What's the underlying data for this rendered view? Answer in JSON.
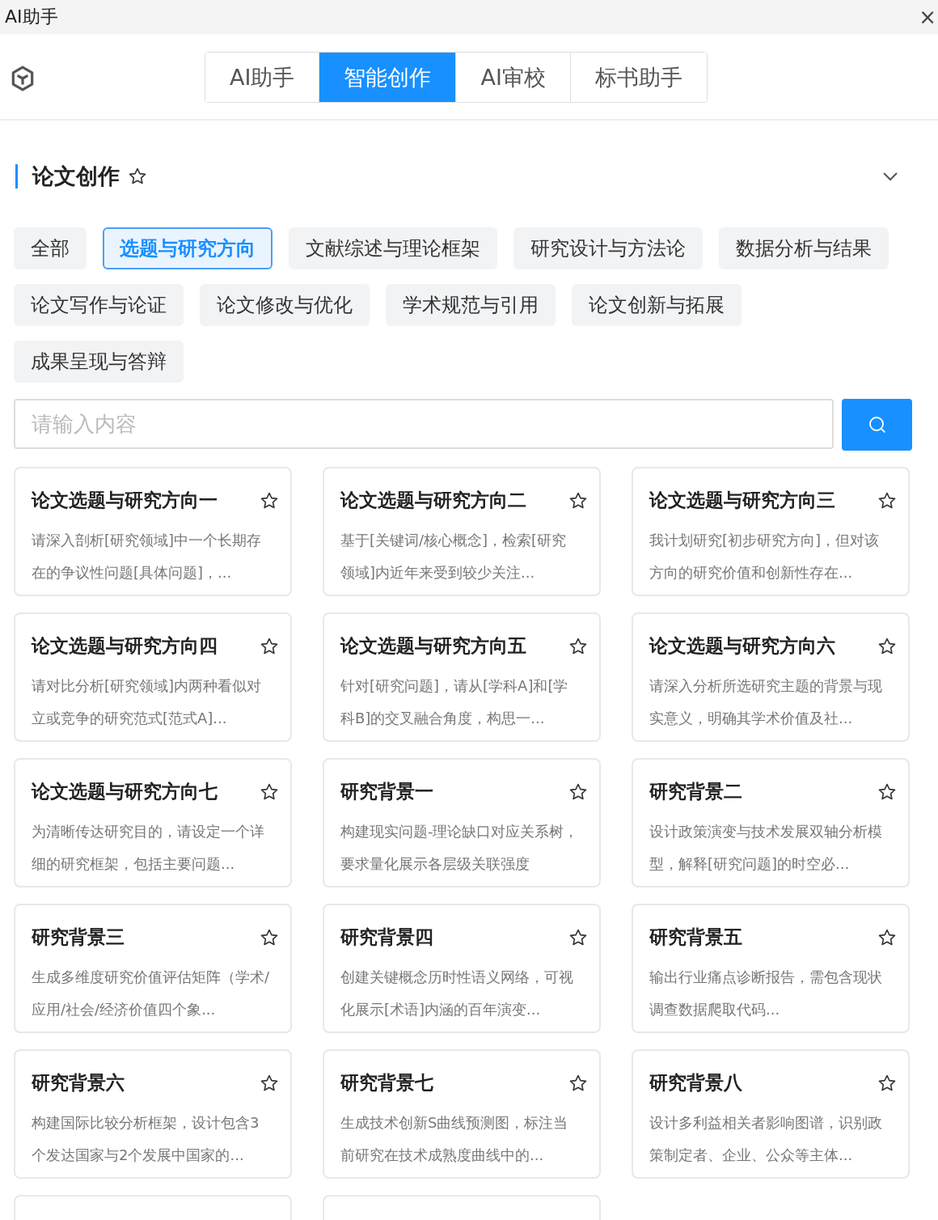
{
  "window": {
    "title": "AI助手",
    "close": "×"
  },
  "tabs": [
    {
      "label": "AI助手",
      "selected": false
    },
    {
      "label": "智能创作",
      "selected": true
    },
    {
      "label": "AI审校",
      "selected": false
    },
    {
      "label": "标书助手",
      "selected": false
    }
  ],
  "section": {
    "title": "论文创作",
    "starred": false,
    "expanded": true
  },
  "categories": [
    {
      "label": "全部",
      "selected": false
    },
    {
      "label": "选题与研究方向",
      "selected": true
    },
    {
      "label": "文献综述与理论框架",
      "selected": false
    },
    {
      "label": "研究设计与方法论",
      "selected": false
    },
    {
      "label": "数据分析与结果",
      "selected": false
    },
    {
      "label": "论文写作与论证",
      "selected": false
    },
    {
      "label": "论文修改与优化",
      "selected": false
    },
    {
      "label": "学术规范与引用",
      "selected": false
    },
    {
      "label": "论文创新与拓展",
      "selected": false
    },
    {
      "label": "成果呈现与答辩",
      "selected": false
    }
  ],
  "search": {
    "placeholder": "请输入内容"
  },
  "cards": [
    {
      "kind": "card",
      "title": "论文选题与研究方向一",
      "description": "请深入剖析[研究领域]中一个长期存在的争议性问题[具体问题]，...",
      "starred": false
    },
    {
      "kind": "card",
      "title": "论文选题与研究方向二",
      "description": "基于[关键词/核心概念]，检索[研究领域]内近年来受到较少关注...",
      "starred": false
    },
    {
      "kind": "card",
      "title": "论文选题与研究方向三",
      "description": "我计划研究[初步研究方向]，但对该方向的研究价值和创新性存在...",
      "starred": false
    },
    {
      "kind": "card",
      "title": "论文选题与研究方向四",
      "description": "请对比分析[研究领域]内两种看似对立或竞争的研究范式[范式A]...",
      "starred": false
    },
    {
      "kind": "card",
      "title": "论文选题与研究方向五",
      "description": "针对[研究问题]，请从[学科A]和[学科B]的交叉融合角度，构思一...",
      "starred": false
    },
    {
      "kind": "card",
      "title": "论文选题与研究方向六",
      "description": "请深入分析所选研究主题的背景与现实意义，明确其学术价值及社...",
      "starred": false
    },
    {
      "kind": "card",
      "title": "论文选题与研究方向七",
      "description": "为清晰传达研究目的，请设定一个详细的研究框架，包括主要问题...",
      "starred": false
    },
    {
      "kind": "card",
      "title": "研究背景一",
      "description": "构建现实问题-理论缺口对应关系树，要求量化展示各层级关联强度",
      "starred": false
    },
    {
      "kind": "card",
      "title": "研究背景二",
      "description": "设计政策演变与技术发展双轴分析模型，解释[研究问题]的时空必...",
      "starred": false
    },
    {
      "kind": "card",
      "title": "研究背景三",
      "description": "生成多维度研究价值评估矩阵（学术/应用/社会/经济价值四个象...",
      "starred": false
    },
    {
      "kind": "card",
      "title": "研究背景四",
      "description": "创建关键概念历时性语义网络，可视化展示[术语]内涵的百年演变...",
      "starred": false
    },
    {
      "kind": "card",
      "title": "研究背景五",
      "description": "输出行业痛点诊断报告，需包含现状调查数据爬取代码...",
      "starred": false
    },
    {
      "kind": "card",
      "title": "研究背景六",
      "description": "构建国际比较分析框架，设计包含3个发达国家与2个发展中国家的...",
      "starred": false
    },
    {
      "kind": "card",
      "title": "研究背景七",
      "description": "生成技术创新S曲线预测图，标注当前研究在技术成熟度曲线中的...",
      "starred": false
    },
    {
      "kind": "card",
      "title": "研究背景八",
      "description": "设计多利益相关者影响图谱，识别政策制定者、企业、公众等主体...",
      "starred": false
    },
    {
      "kind": "stub"
    },
    {
      "kind": "stub"
    }
  ]
}
